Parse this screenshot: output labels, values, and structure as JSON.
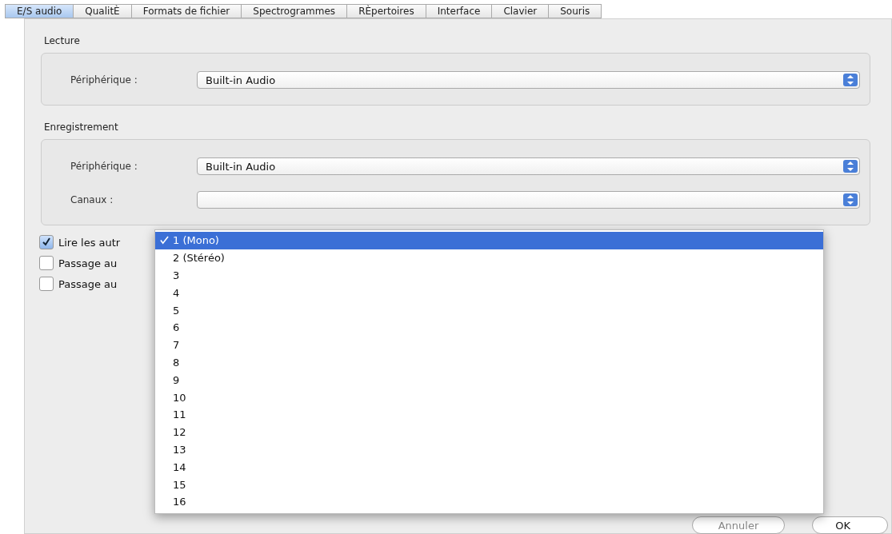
{
  "tabs": [
    {
      "label": "E/S audio",
      "selected": true
    },
    {
      "label": "QualitÈ",
      "selected": false
    },
    {
      "label": "Formats de fichier",
      "selected": false
    },
    {
      "label": "Spectrogrammes",
      "selected": false
    },
    {
      "label": "RÈpertoires",
      "selected": false
    },
    {
      "label": "Interface",
      "selected": false
    },
    {
      "label": "Clavier",
      "selected": false
    },
    {
      "label": "Souris",
      "selected": false
    }
  ],
  "playback": {
    "title": "Lecture",
    "device_label": "Périphérique :",
    "device": "Built-in Audio"
  },
  "recording": {
    "title": "Enregistrement",
    "device_label": "Périphérique :",
    "device": "Built-in Audio",
    "channels_label": "Canaux :"
  },
  "options": [
    {
      "label": "Lire les autr",
      "checked": true
    },
    {
      "label": "Passage au",
      "checked": false
    },
    {
      "label": "Passage au",
      "checked": false
    }
  ],
  "channels_menu": [
    {
      "label": "1 (Mono)",
      "selected": true
    },
    {
      "label": "2 (Stéréo)",
      "selected": false
    },
    {
      "label": "3",
      "selected": false
    },
    {
      "label": "4",
      "selected": false
    },
    {
      "label": "5",
      "selected": false
    },
    {
      "label": "6",
      "selected": false
    },
    {
      "label": "7",
      "selected": false
    },
    {
      "label": "8",
      "selected": false
    },
    {
      "label": "9",
      "selected": false
    },
    {
      "label": "10",
      "selected": false
    },
    {
      "label": "11",
      "selected": false
    },
    {
      "label": "12",
      "selected": false
    },
    {
      "label": "13",
      "selected": false
    },
    {
      "label": "14",
      "selected": false
    },
    {
      "label": "15",
      "selected": false
    },
    {
      "label": "16",
      "selected": false
    }
  ],
  "buttons": [
    {
      "label": "Annuler",
      "kind": "cancel"
    },
    {
      "label": "OK",
      "kind": "default"
    }
  ]
}
